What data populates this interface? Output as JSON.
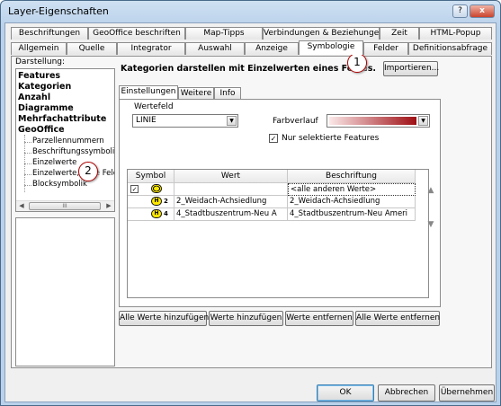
{
  "window": {
    "title": "Layer-Eigenschaften",
    "help": "?",
    "close": "x"
  },
  "tabs_row1": [
    "Beschriftungen",
    "GeoOffice beschriften",
    "Map-Tipps",
    "Verbindungen & Beziehungen",
    "Zeit",
    "HTML-Popup"
  ],
  "tabs_row2": [
    "Allgemein",
    "Quelle",
    "Integrator",
    "Auswahl",
    "Anzeige",
    "Symbologie",
    "Felder",
    "Definitionsabfrage"
  ],
  "left": {
    "label": "Darstellung:",
    "categories": [
      "Features",
      "Kategorien",
      "Anzahl",
      "Diagramme",
      "Mehrfachattribute",
      "GeoOffice"
    ],
    "sub_items": [
      "Parzellennummern",
      "Beschriftungssymbolik",
      "Einzelwerte",
      "Einzelwerte, viele Felder",
      "Blocksymbolik"
    ],
    "scroll_thumb": "III"
  },
  "main": {
    "heading": "Kategorien darstellen mit Einzelwerten eines Feldes.",
    "import_button": "Importieren...",
    "inner_tabs": [
      "Einstellungen",
      "Weitere",
      "Info"
    ],
    "value_field_label": "Wertefeld",
    "value_field": "LINIE",
    "color_ramp_label": "Farbverlauf",
    "selected_only_label": "Nur selektierte Features",
    "selected_only_checked": true,
    "color_ramp": {
      "from": "#fbe8e8",
      "to": "#9e0f14"
    },
    "grid": {
      "headers": [
        "Symbol",
        "Wert",
        "Beschriftung"
      ],
      "rows": [
        {
          "checkbox": "✓",
          "symbol_text": "",
          "wert": "",
          "beschriftung": "<alle anderen Werte>"
        },
        {
          "checkbox": "",
          "symbol_text": "2",
          "wert": "2_Weidach-Achsiedlung",
          "beschriftung": "2_Weidach-Achsiedlung"
        },
        {
          "checkbox": "",
          "symbol_text": "4",
          "wert": "4_Stadtbuszentrum-Neu A",
          "beschriftung": "4_Stadtbuszentrum-Neu Ameri"
        }
      ]
    },
    "buttons": [
      "Alle Werte hinzufügen",
      "Werte hinzufügen",
      "Werte entfernen",
      "Alle Werte entfernen"
    ]
  },
  "footer": {
    "ok": "OK",
    "cancel": "Abbrechen",
    "apply": "Übernehmen"
  },
  "callouts": [
    "1",
    "2"
  ],
  "colors": {
    "callout_border": "#b00000",
    "symbol_fill": "#ffe800"
  }
}
